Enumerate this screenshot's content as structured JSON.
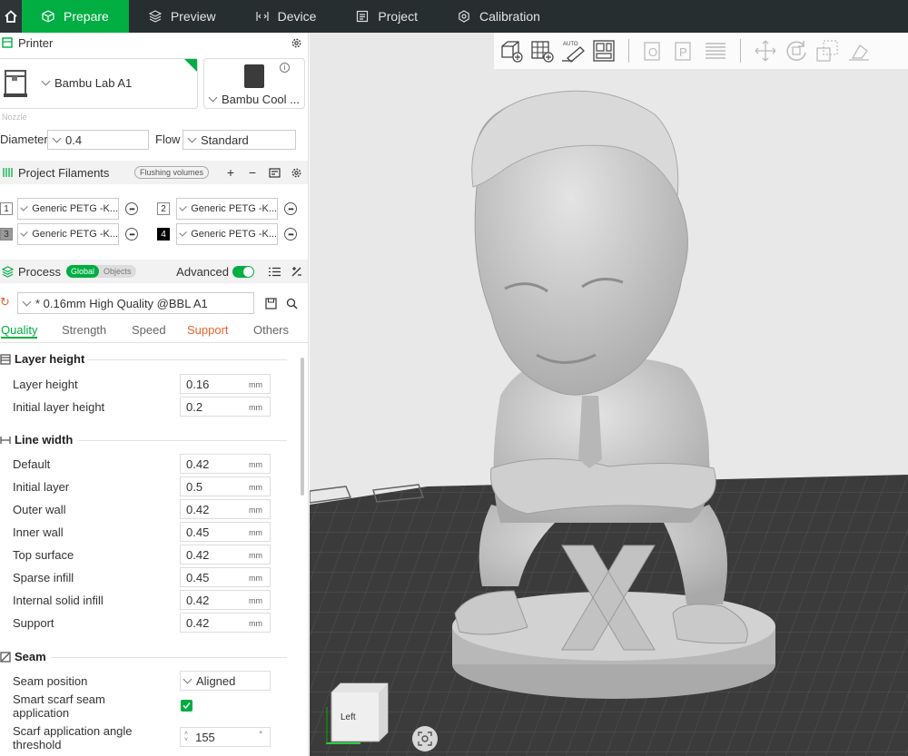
{
  "topbar": {
    "tabs": [
      {
        "label": "Prepare",
        "icon": "cube-icon",
        "active": true
      },
      {
        "label": "Preview",
        "icon": "layers-icon",
        "active": false
      },
      {
        "label": "Device",
        "icon": "code-icon",
        "active": false
      },
      {
        "label": "Project",
        "icon": "document-icon",
        "active": false
      },
      {
        "label": "Calibration",
        "icon": "calibration-icon",
        "active": false
      }
    ]
  },
  "printer": {
    "title": "Printer",
    "name": "Bambu Lab A1",
    "plate": "Bambu Cool ...",
    "nozzle_label": "Nozzle",
    "diameter_label": "Diameter",
    "diameter_value": "0.4",
    "flow_label": "Flow",
    "flow_value": "Standard"
  },
  "filaments": {
    "title": "Project Filaments",
    "flushing_label": "Flushing volumes",
    "items": [
      {
        "index": "1",
        "name": "Generic PETG -K...",
        "color": "#ffffff"
      },
      {
        "index": "2",
        "name": "Generic PETG -K...",
        "color": "#ffffff"
      },
      {
        "index": "3",
        "name": "Generic PETG -K...",
        "color": "#9a9a9a"
      },
      {
        "index": "4",
        "name": "Generic PETG -K...",
        "color": "#000000"
      }
    ]
  },
  "process": {
    "title": "Process",
    "global_label": "Global",
    "objects_label": "Objects",
    "advanced_label": "Advanced",
    "preset": "* 0.16mm High Quality @BBL A1",
    "tabs": [
      "Quality",
      "Strength",
      "Speed",
      "Support",
      "Others"
    ],
    "active_tab": "Quality",
    "warn_tab": "Support"
  },
  "quality": {
    "layer_height_group": "Layer height",
    "layer_height_label": "Layer height",
    "layer_height_value": "0.16",
    "initial_layer_height_label": "Initial layer height",
    "initial_layer_height_value": "0.2",
    "line_width_group": "Line width",
    "line_widths": [
      {
        "label": "Default",
        "value": "0.42"
      },
      {
        "label": "Initial layer",
        "value": "0.5"
      },
      {
        "label": "Outer wall",
        "value": "0.42"
      },
      {
        "label": "Inner wall",
        "value": "0.45"
      },
      {
        "label": "Top surface",
        "value": "0.42"
      },
      {
        "label": "Sparse infill",
        "value": "0.45"
      },
      {
        "label": "Internal solid infill",
        "value": "0.42"
      },
      {
        "label": "Support",
        "value": "0.42"
      }
    ],
    "unit": "mm",
    "seam_group": "Seam",
    "seam_position_label": "Seam position",
    "seam_position_value": "Aligned",
    "scarf_label_1": "Smart scarf seam",
    "scarf_label_2": "application",
    "scarf_checked": true,
    "scarf_angle_label_1": "Scarf application angle",
    "scarf_angle_label_2": "threshold",
    "scarf_angle_value": "155",
    "scarf_angle_unit": "°"
  },
  "viewport": {
    "view_cube_label": "Left",
    "toolbar_icons": [
      "add-object-icon",
      "add-plate-icon",
      "auto-orient-icon",
      "arrange-icon",
      "split-objects-icon",
      "split-parts-icon",
      "layer-editing-icon",
      "move-icon",
      "rotate-icon",
      "scale-icon",
      "lay-on-face-icon"
    ],
    "model_label": "X"
  },
  "colors": {
    "accent": "#00ae42",
    "warn": "#e8642d",
    "topbar": "#262e30",
    "bed": "#3b3b3b",
    "model": "#c4c4c4"
  }
}
